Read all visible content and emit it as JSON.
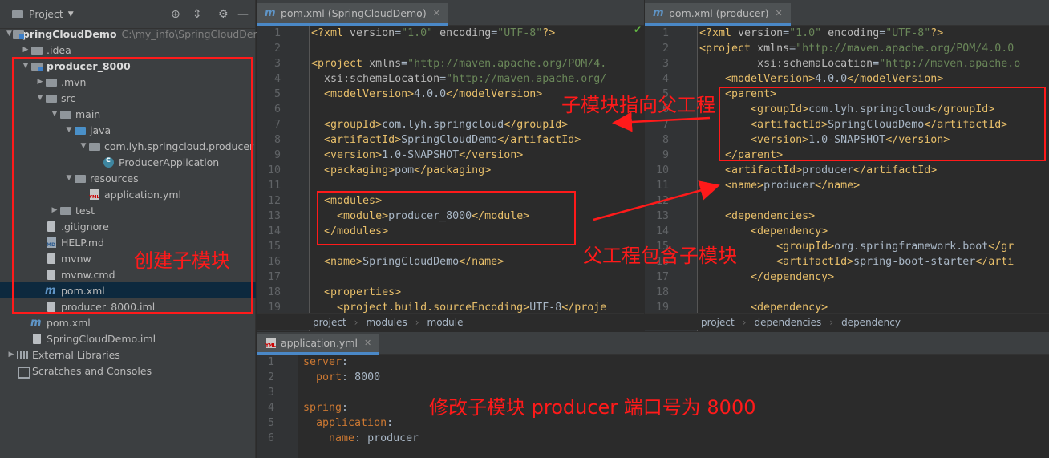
{
  "project_panel": {
    "title": "Project",
    "tree": [
      {
        "label": "SpringCloudDemo",
        "hint": "C:\\my_info\\SpringCloudDemo",
        "icon": "module-folder-icon",
        "depth": 0,
        "expanded": true,
        "bold": true
      },
      {
        "label": ".idea",
        "icon": "folder-icon",
        "depth": 1,
        "expanded": false
      },
      {
        "label": "producer_8000",
        "icon": "module-folder-icon",
        "depth": 1,
        "expanded": true,
        "bold": true
      },
      {
        "label": ".mvn",
        "icon": "folder-icon",
        "depth": 2,
        "expanded": false
      },
      {
        "label": "src",
        "icon": "folder-icon",
        "depth": 2,
        "expanded": true
      },
      {
        "label": "main",
        "icon": "folder-icon",
        "depth": 3,
        "expanded": true
      },
      {
        "label": "java",
        "icon": "source-folder-icon",
        "depth": 4,
        "expanded": true
      },
      {
        "label": "com.lyh.springcloud.producer",
        "icon": "package-icon",
        "depth": 5,
        "expanded": true
      },
      {
        "label": "ProducerApplication",
        "icon": "spring-class-icon",
        "depth": 6
      },
      {
        "label": "resources",
        "icon": "resources-folder-icon",
        "depth": 4,
        "expanded": true
      },
      {
        "label": "application.yml",
        "icon": "yml-file-icon",
        "depth": 5
      },
      {
        "label": "test",
        "icon": "folder-icon",
        "depth": 3,
        "expanded": false
      },
      {
        "label": ".gitignore",
        "icon": "file-icon",
        "depth": 2
      },
      {
        "label": "HELP.md",
        "icon": "md-file-icon",
        "depth": 2
      },
      {
        "label": "mvnw",
        "icon": "file-icon",
        "depth": 2
      },
      {
        "label": "mvnw.cmd",
        "icon": "file-icon",
        "depth": 2
      },
      {
        "label": "pom.xml",
        "icon": "maven-icon",
        "depth": 2,
        "selected": true
      },
      {
        "label": "producer_8000.iml",
        "icon": "file-icon",
        "depth": 2
      },
      {
        "label": "pom.xml",
        "icon": "maven-icon",
        "depth": 1
      },
      {
        "label": "SpringCloudDemo.iml",
        "icon": "file-icon",
        "depth": 1
      },
      {
        "label": "External Libraries",
        "icon": "libraries-icon",
        "depth": 0,
        "expanded": false
      },
      {
        "label": "Scratches and Consoles",
        "icon": "scratches-icon",
        "depth": 0
      }
    ]
  },
  "editor_left": {
    "tab": "pom.xml (SpringCloudDemo)",
    "breadcrumb": [
      "project",
      "modules",
      "module"
    ],
    "lines": [
      "<?xml version=\"1.0\" encoding=\"UTF-8\"?>",
      "",
      "<project xmlns=\"http://maven.apache.org/POM/4.",
      "  xsi:schemaLocation=\"http://maven.apache.org/",
      "  <modelVersion>4.0.0</modelVersion>",
      "",
      "  <groupId>com.lyh.springcloud</groupId>",
      "  <artifactId>SpringCloudDemo</artifactId>",
      "  <version>1.0-SNAPSHOT</version>",
      "  <packaging>pom</packaging>",
      "",
      "  <modules>",
      "    <module>producer_8000</module>",
      "  </modules>",
      "",
      "  <name>SpringCloudDemo</name>",
      "",
      "  <properties>",
      "    <project.build.sourceEncoding>UTF-8</proje"
    ]
  },
  "editor_right": {
    "tab": "pom.xml (producer)",
    "breadcrumb": [
      "project",
      "dependencies",
      "dependency"
    ],
    "lines": [
      "<?xml version=\"1.0\" encoding=\"UTF-8\"?>",
      "<project xmlns=\"http://maven.apache.org/POM/4.0.0",
      "         xsi:schemaLocation=\"http://maven.apache.o",
      "    <modelVersion>4.0.0</modelVersion>",
      "    <parent>",
      "        <groupId>com.lyh.springcloud</groupId>",
      "        <artifactId>SpringCloudDemo</artifactId>",
      "        <version>1.0-SNAPSHOT</version>",
      "    </parent>",
      "    <artifactId>producer</artifactId>",
      "    <name>producer</name>",
      "",
      "    <dependencies>",
      "        <dependency>",
      "            <groupId>org.springframework.boot</gr",
      "            <artifactId>spring-boot-starter</arti",
      "        </dependency>",
      "",
      "        <dependency>"
    ]
  },
  "editor_bottom": {
    "tab": "application.yml",
    "lines": [
      "server:",
      "  port: 8000",
      "",
      "spring:",
      "  application:",
      "    name: producer"
    ]
  },
  "annotations": {
    "child_points_parent": "子模块指向父工程",
    "parent_contains_child": "父工程包含子模块",
    "create_submodule": "创建子模块",
    "change_port": "修改子模块 producer 端口号为 8000"
  },
  "colors": {
    "annotation": "#ff1a1a",
    "tag": "#e8bf6a",
    "value": "#6a8759",
    "selection": "#0d293e"
  }
}
